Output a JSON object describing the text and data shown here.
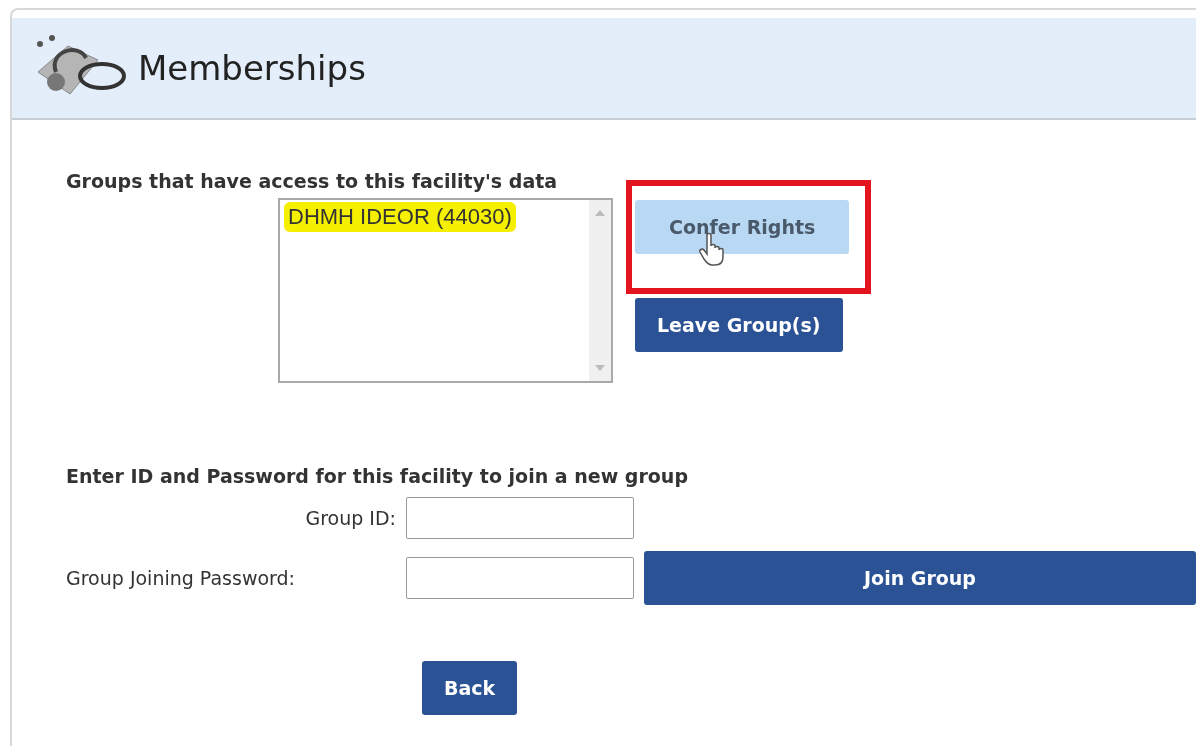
{
  "header": {
    "title": "Memberships"
  },
  "groups": {
    "label": "Groups that have access to this facility's data",
    "items": [
      {
        "text": "DHMH IDEOR (44030)",
        "highlighted": true
      }
    ],
    "buttons": [
      {
        "label": "Confer Rights",
        "hovered": true,
        "annotated": true
      },
      {
        "label": "Leave Group(s)",
        "hovered": false,
        "annotated": false
      }
    ]
  },
  "join": {
    "label": "Enter ID and Password for this facility to join a new group",
    "fields": [
      {
        "label": "Group ID:"
      },
      {
        "label": "Group Joining Password:"
      }
    ],
    "button": {
      "label": "Join Group"
    }
  },
  "back": {
    "label": "Back"
  }
}
